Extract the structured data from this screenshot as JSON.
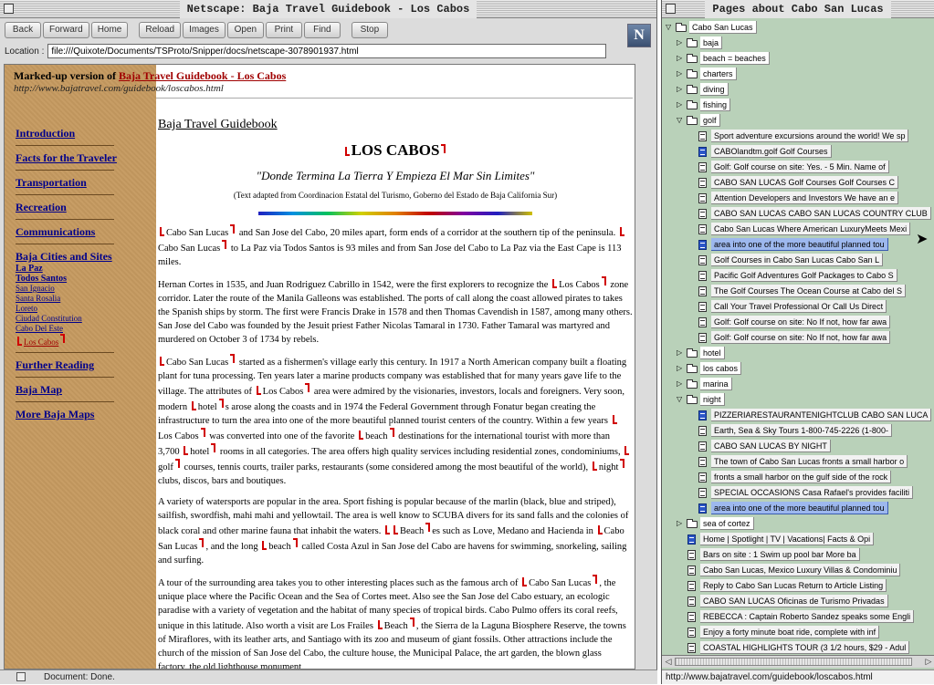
{
  "browser": {
    "title": "Netscape: Baja Travel Guidebook - Los Cabos",
    "toolbar": [
      "Back",
      "Forward",
      "Home",
      "Reload",
      "Images",
      "Open",
      "Print",
      "Find",
      "Stop"
    ],
    "location_label": "Location :",
    "location_url": "file:///Quixote/Documents/TSProto/Snipper/docs/netscape-3078901937.html",
    "status": "Document: Done."
  },
  "page": {
    "marked_prefix": "Marked-up version of",
    "marked_link": "Baja Travel Guidebook - Los Cabos",
    "marked_url": "http://www.bajatravel.com/guidebook/loscabos.html",
    "nav": {
      "introduction": "Introduction",
      "facts": "Facts for the Traveler",
      "transportation": "Transportation",
      "recreation": "Recreation",
      "communications": "Communications",
      "cities": "Baja Cities and Sites",
      "city_items": [
        "La Paz",
        "Todos Santos",
        "San Ignacio",
        "Santa Rosalia",
        "Loreto",
        "Ciudad Constitution",
        "Cabo Del Este",
        "Los Cabos"
      ],
      "further": "Further Reading",
      "map": "Baja Map",
      "more_maps": "More Baja Maps"
    },
    "guide_title": "Baja Travel Guidebook",
    "heading": "LOS CABOS",
    "quote": "\"Donde Termina La Tierra Y Empieza El Mar Sin Limites\"",
    "adapted": "(Text adapted from Coordinacion Estatal del Turismo, Goberno del Estado de Baja California Sur)",
    "p1": {
      "a": "Cabo San Lucas",
      "b": " and San Jose del Cabo, 20 miles apart, form ends of a corridor at the southern tip of the peninsula. ",
      "c": "Cabo San Lucas",
      "d": " to La Paz via Todos Santos is 93 miles and from San Jose del Cabo to La Paz via the East Cape is 113 miles."
    },
    "p2": {
      "a": "Hernan Cortes in 1535, and Juan Rodriguez Cabrillo in 1542, were the first explorers to recognize the ",
      "b": "Los Cabos",
      "c": " zone corridor. Later the route of the Manila Galleons was established. The ports of call along the coast allowed pirates to takes the Spanish ships by storm. The first were Francis Drake in 1578 and then Thomas Cavendish in 1587, among many others. San Jose del Cabo was founded by the Jesuit priest Father Nicolas Tamaral in 1730. Father Tamaral was martyred and murdered on October 3 of 1734 by rebels."
    },
    "p3": {
      "a": "Cabo San Lucas",
      "b": " started as a fishermen's village early this century. In 1917 a North American company built a floating plant for tuna processing. Ten years later a marine products company was established that for many years gave life to the village. The attributes of ",
      "c": "Los Cabos",
      "d": " area were admired by the visionaries, investors, locals and foreigners. Very soon, modern ",
      "e": "hotel",
      "f": "s arose along the coasts and in 1974 the Federal Government through Fonatur began creating the infrastructure to turn the area into one of the more beautiful planned tourist centers of the country. Within a few years ",
      "g": "Los Cabos",
      "h": " was converted into one of the favorite ",
      "i": "beach",
      "j": " destinations for the international tourist with more than 3,700 ",
      "k": "hotel",
      "l": " rooms in all categories. The area offers high quality services including residential zones, condominiums, ",
      "m": "golf",
      "n": " courses, tennis courts, trailer parks, restaurants (some considered among the most beautiful of the world), ",
      "o": "night",
      "p": " clubs, discos, bars and boutiques."
    },
    "p4": {
      "a": "A variety of watersports are popular in the area. Sport fishing is popular because of the marlin (black, blue and striped), sailfish, swordfish, mahi mahi and yellowtail. The area is well know to SCUBA divers for its sand falls and the colonies of black coral and other marine fauna that inhabit the waters. ",
      "b": "Beach",
      "c": "es such as Love, Medano and Hacienda in ",
      "d": "Cabo San Lucas",
      "e": ", and the long ",
      "f": "beach",
      "g": " called Costa Azul in San Jose del Cabo are havens for swimming, snorkeling, sailing and surfing."
    },
    "p5": {
      "a": "A tour of the surrounding area takes you to other interesting places such as the famous arch of ",
      "b": "Cabo San Lucas",
      "c": ", the unique place where the Pacific Ocean and the Sea of Cortes meet. Also see the San Jose del Cabo estuary, an ecologic paradise with a variety of vegetation and the habitat of many species of tropical birds. Cabo Pulmo offers its coral reefs, unique in this latitude. Also worth a visit are Los Frailes ",
      "d": "Beach",
      "e": ", the Sierra de la Laguna Biosphere Reserve, the towns of Miraflores, with its leather arts, and Santiago with its zoo and museum of giant fossils. Other attractions include the church of the mission of San Jose del Cabo, the culture house, the Municipal Palace, the art garden, the blown glass factory, the old lighthouse monument"
    }
  },
  "tree": {
    "title": "Pages about Cabo San Lucas",
    "status": "http://www.bajatravel.com/guidebook/loscabos.html",
    "rows": [
      {
        "t": "folder",
        "open": true,
        "l": 0,
        "label": "Cabo San Lucas"
      },
      {
        "t": "folder",
        "open": false,
        "l": 1,
        "label": "baja"
      },
      {
        "t": "folder",
        "open": false,
        "l": 1,
        "label": "beach = beaches"
      },
      {
        "t": "folder",
        "open": false,
        "l": 1,
        "label": "charters"
      },
      {
        "t": "folder",
        "open": false,
        "l": 1,
        "label": "diving"
      },
      {
        "t": "folder",
        "open": false,
        "l": 1,
        "label": "fishing"
      },
      {
        "t": "folder",
        "open": true,
        "l": 1,
        "label": "golf"
      },
      {
        "t": "doc",
        "blue": false,
        "l": 2,
        "label": "Sport adventure excursions around the world! We sp"
      },
      {
        "t": "doc",
        "blue": true,
        "l": 2,
        "label": "CABOlandtm.golf        Golf Courses"
      },
      {
        "t": "doc",
        "blue": false,
        "l": 2,
        "label": "Golf:   Golf course on site: Yes. - 5 Min. Name of"
      },
      {
        "t": "doc",
        "blue": false,
        "l": 2,
        "label": "CABO SAN LUCAS  Golf Courses  Golf Courses     C"
      },
      {
        "t": "doc",
        "blue": false,
        "l": 2,
        "label": "Attention Developers and Investors    We have an e"
      },
      {
        "t": "doc",
        "blue": false,
        "l": 2,
        "label": "CABO SAN LUCAS  CABO SAN LUCAS COUNTRY CLUB"
      },
      {
        "t": "doc",
        "blue": false,
        "l": 2,
        "label": "Cabo San Lucas  Where American LuxuryMeets Mexi"
      },
      {
        "t": "doc",
        "blue": true,
        "l": 2,
        "hl": true,
        "label": "area into one of the more beautiful      planned tou"
      },
      {
        "t": "doc",
        "blue": false,
        "l": 2,
        "label": "Golf Courses in Cabo San Lucas       Cabo San L"
      },
      {
        "t": "doc",
        "blue": false,
        "l": 2,
        "label": "Pacific Golf Adventures    Golf Packages to Cabo S"
      },
      {
        "t": "doc",
        "blue": false,
        "l": 2,
        "label": "The Golf Courses      The Ocean Course at Cabo del S"
      },
      {
        "t": "doc",
        "blue": false,
        "l": 2,
        "label": "Call Your Travel Professional    Or Call Us Direct"
      },
      {
        "t": "doc",
        "blue": false,
        "l": 2,
        "label": "Golf:  Golf course on site: No If not, how far awa"
      },
      {
        "t": "doc",
        "blue": false,
        "l": 2,
        "label": "Golf:  Golf course on site: No If not, how far awa"
      },
      {
        "t": "folder",
        "open": false,
        "l": 1,
        "label": "hotel"
      },
      {
        "t": "folder",
        "open": false,
        "l": 1,
        "label": "los cabos"
      },
      {
        "t": "folder",
        "open": false,
        "l": 1,
        "label": "marina"
      },
      {
        "t": "folder",
        "open": true,
        "l": 1,
        "label": "night"
      },
      {
        "t": "doc",
        "blue": true,
        "l": 2,
        "label": "PIZZERIARESTAURANTENIGHTCLUB   CABO SAN LUCA"
      },
      {
        "t": "doc",
        "blue": false,
        "l": 2,
        "label": "Earth, Sea & Sky Tours   1-800-745-2226 (1-800-"
      },
      {
        "t": "doc",
        "blue": false,
        "l": 2,
        "label": "CABO SAN LUCAS BY NIGHT"
      },
      {
        "t": "doc",
        "blue": false,
        "l": 2,
        "label": "The town of Cabo San Lucas fronts a small harbor o"
      },
      {
        "t": "doc",
        "blue": false,
        "l": 2,
        "label": "fronts a small harbor on the gulf side of the rock"
      },
      {
        "t": "doc",
        "blue": false,
        "l": 2,
        "label": "SPECIAL OCCASIONS  Casa Rafael's provides faciliti"
      },
      {
        "t": "doc",
        "blue": true,
        "l": 2,
        "hl": true,
        "label": "area into one of the more beautiful      planned tou"
      },
      {
        "t": "folder",
        "open": false,
        "l": 1,
        "label": "sea of cortez"
      },
      {
        "t": "doc",
        "blue": true,
        "l": 1,
        "label": "Home | Spotlight |  TV |  Vacations|  Facts & Opi"
      },
      {
        "t": "doc",
        "blue": false,
        "l": 1,
        "label": "Bars on site : 1        Swim up pool bar      More ba"
      },
      {
        "t": "doc",
        "blue": false,
        "l": 1,
        "label": "Cabo San Lucas, Mexico  Luxury Villas & Condominiu"
      },
      {
        "t": "doc",
        "blue": false,
        "l": 1,
        "label": "Reply to Cabo San Lucas  Return to Article Listing"
      },
      {
        "t": "doc",
        "blue": false,
        "l": 1,
        "label": "CABO SAN LUCAS  Oficinas de Turismo  Privadas"
      },
      {
        "t": "doc",
        "blue": false,
        "l": 1,
        "label": "REBECCA :  Captain Roberto Sandez speaks some Engli"
      },
      {
        "t": "doc",
        "blue": false,
        "l": 1,
        "label": "Enjoy a forty minute boat ride, complete with  inf"
      },
      {
        "t": "doc",
        "blue": false,
        "l": 1,
        "label": "COASTAL HIGHLIGHTS TOUR  (3 1/2 hours, $29 - Adul"
      }
    ]
  }
}
